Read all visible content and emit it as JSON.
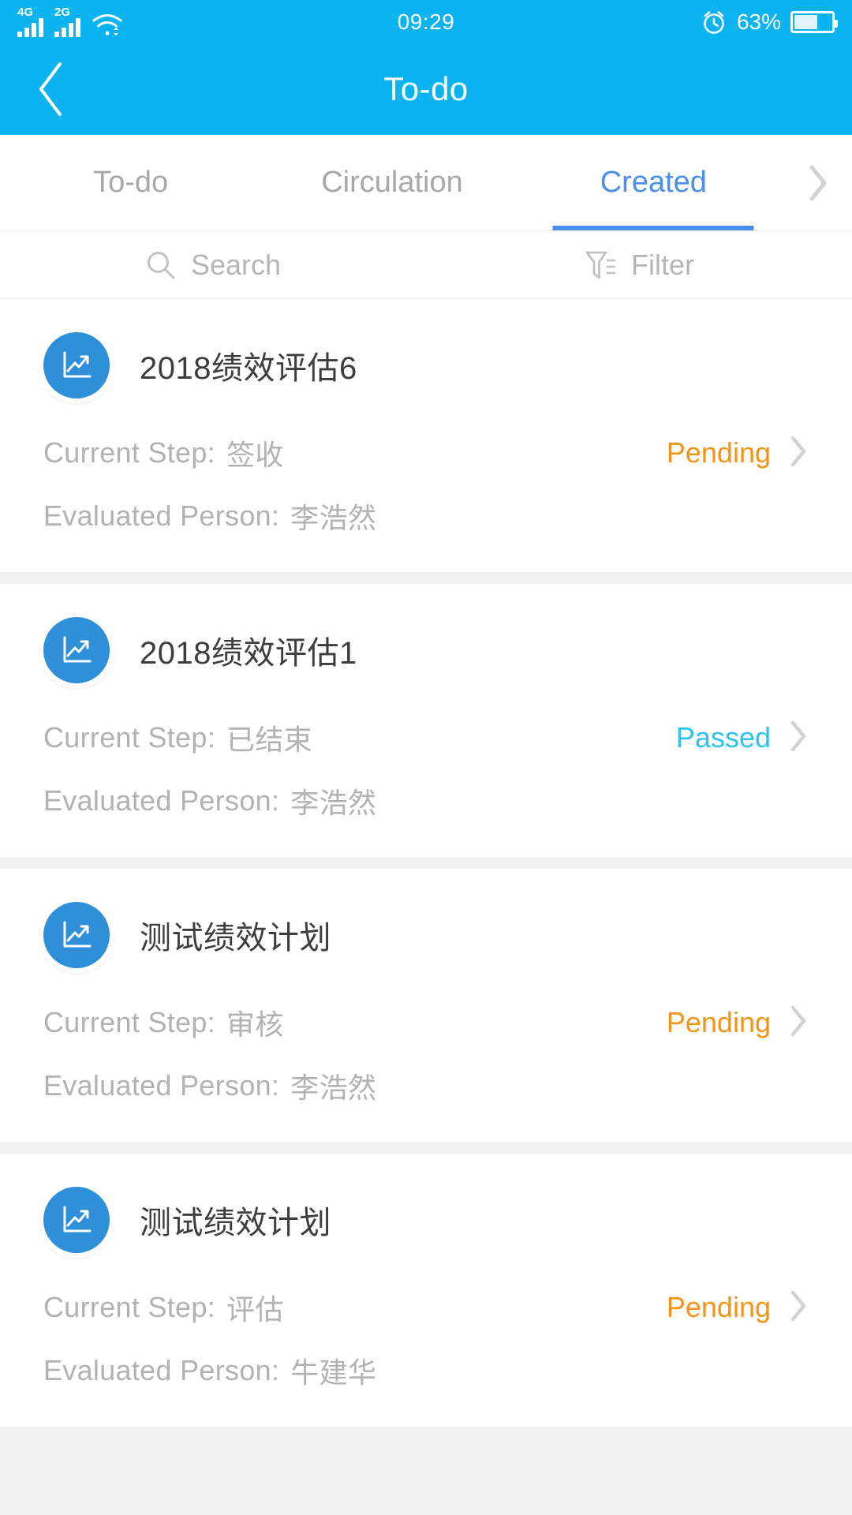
{
  "statusbar": {
    "networks": [
      {
        "label": "4G",
        "icon": "signal-bars-icon"
      },
      {
        "label": "2G",
        "icon": "signal-bars-icon"
      }
    ],
    "wifi_icon": "wifi-icon",
    "time": "09:29",
    "alarm_icon": "alarm-clock-icon",
    "battery_percent": "63%",
    "battery_level": 63
  },
  "header": {
    "back_icon": "back-chevron-icon",
    "title": "To-do"
  },
  "tabs": {
    "items": [
      {
        "label": "To-do",
        "active": false
      },
      {
        "label": "Circulation",
        "active": false
      },
      {
        "label": "Created",
        "active": true
      }
    ],
    "more_icon": "chevron-right-icon",
    "active_color": "#4a8ff0",
    "inactive_color": "#a8a8a8"
  },
  "toolbar": {
    "search": {
      "icon": "search-icon",
      "placeholder": "Search",
      "value": "Search"
    },
    "filter": {
      "icon": "filter-icon",
      "label": "Filter"
    }
  },
  "labels": {
    "current_step": "Current Step:",
    "evaluated_person": "Evaluated Person:"
  },
  "colors": {
    "brand": "#0bb4f0",
    "accent": "#4a8ff0",
    "pending": "#f59315",
    "passed": "#2bc3f5",
    "avatar": "#2f8fd8"
  },
  "list": {
    "items": [
      {
        "icon": "chart-trend-icon",
        "title": "2018绩效评估6",
        "current_step": "签收",
        "evaluated_person": "李浩然",
        "status": "Pending",
        "status_kind": "pending",
        "chevron_icon": "chevron-right-icon"
      },
      {
        "icon": "chart-trend-icon",
        "title": "2018绩效评估1",
        "current_step": "已结束",
        "evaluated_person": "李浩然",
        "status": "Passed",
        "status_kind": "passed",
        "chevron_icon": "chevron-right-icon"
      },
      {
        "icon": "chart-trend-icon",
        "title": "测试绩效计划",
        "current_step": "审核",
        "evaluated_person": "李浩然",
        "status": "Pending",
        "status_kind": "pending",
        "chevron_icon": "chevron-right-icon"
      },
      {
        "icon": "chart-trend-icon",
        "title": "测试绩效计划",
        "current_step": "评估",
        "evaluated_person": "牛建华",
        "status": "Pending",
        "status_kind": "pending",
        "chevron_icon": "chevron-right-icon"
      }
    ]
  }
}
